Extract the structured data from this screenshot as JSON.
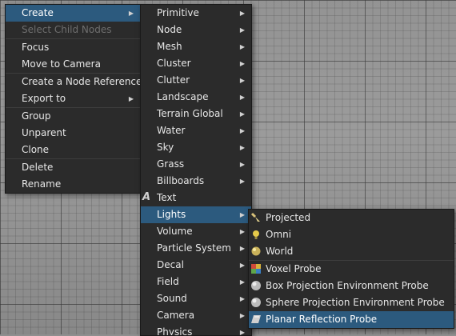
{
  "context_menu": {
    "items": [
      {
        "label": "Create"
      },
      {
        "label": "Select Child Nodes"
      },
      {
        "label": "Focus"
      },
      {
        "label": "Move to Camera"
      },
      {
        "label": "Create a Node Reference"
      },
      {
        "label": "Export to"
      },
      {
        "label": "Group"
      },
      {
        "label": "Unparent"
      },
      {
        "label": "Clone"
      },
      {
        "label": "Delete"
      },
      {
        "label": "Rename"
      }
    ]
  },
  "create_submenu": {
    "items": [
      {
        "label": "Primitive"
      },
      {
        "label": "Node"
      },
      {
        "label": "Mesh"
      },
      {
        "label": "Cluster"
      },
      {
        "label": "Clutter"
      },
      {
        "label": "Landscape"
      },
      {
        "label": "Terrain Global"
      },
      {
        "label": "Water"
      },
      {
        "label": "Sky"
      },
      {
        "label": "Grass"
      },
      {
        "label": "Billboards"
      },
      {
        "label": "Text"
      },
      {
        "label": "Lights"
      },
      {
        "label": "Volume"
      },
      {
        "label": "Particle System"
      },
      {
        "label": "Decal"
      },
      {
        "label": "Field"
      },
      {
        "label": "Sound"
      },
      {
        "label": "Camera"
      },
      {
        "label": "Physics"
      }
    ]
  },
  "lights_submenu": {
    "items": [
      {
        "label": "Projected",
        "icon": "projected-light-icon"
      },
      {
        "label": "Omni",
        "icon": "omni-light-icon"
      },
      {
        "label": "World",
        "icon": "world-light-icon"
      },
      {
        "label": "Voxel Probe",
        "icon": "voxel-probe-icon"
      },
      {
        "label": "Box Projection Environment Probe",
        "icon": "box-probe-icon"
      },
      {
        "label": "Sphere Projection Environment Probe",
        "icon": "sphere-probe-icon"
      },
      {
        "label": "Planar Reflection Probe",
        "icon": "planar-probe-icon"
      }
    ]
  },
  "colors": {
    "menu_bg": "#2b2b2b",
    "highlight": "#2c5a7e",
    "text": "#e6e6e6",
    "disabled_text": "#6e6e6e"
  }
}
